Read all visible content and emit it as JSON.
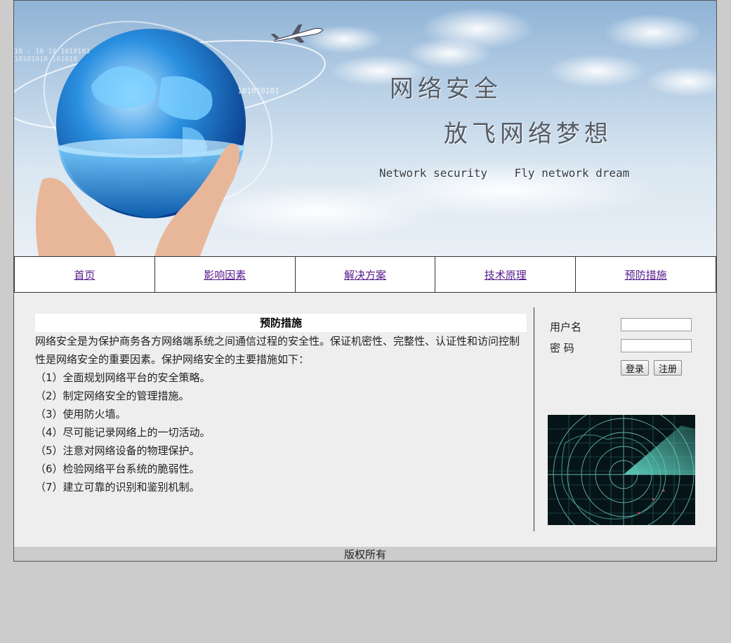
{
  "banner": {
    "title": "网络安全",
    "subtitle": "放飞网络梦想",
    "english": "Network security    Fly network dream"
  },
  "nav": {
    "items": [
      {
        "label": "首页"
      },
      {
        "label": "影响因素"
      },
      {
        "label": "解决方案"
      },
      {
        "label": "技术原理"
      },
      {
        "label": "预防措施"
      }
    ]
  },
  "article": {
    "title": "预防措施",
    "intro": "网络安全是为保护商务各方网络端系统之间通信过程的安全性。保证机密性、完整性、认证性和访问控制性是网络安全的重要因素。保护网络安全的主要措施如下：",
    "items": [
      "（1）全面规划网络平台的安全策略。",
      "（2）制定网络安全的管理措施。",
      "（3）使用防火墙。",
      "（4）尽可能记录网络上的一切活动。",
      "（5）注意对网络设备的物理保护。",
      "（6）检验网络平台系统的脆弱性。",
      "（7）建立可靠的识别和鉴别机制。"
    ]
  },
  "login": {
    "username_label": "用户名",
    "username_value": "",
    "password_label": "密 码",
    "password_value": "",
    "login_button": "登录",
    "register_button": "注册"
  },
  "footer": {
    "text": "版权所有"
  },
  "colors": {
    "page_bg": "#cccccc",
    "content_bg": "#eeeeee",
    "link": "#551a8b",
    "radar": "#5fd3c0"
  }
}
